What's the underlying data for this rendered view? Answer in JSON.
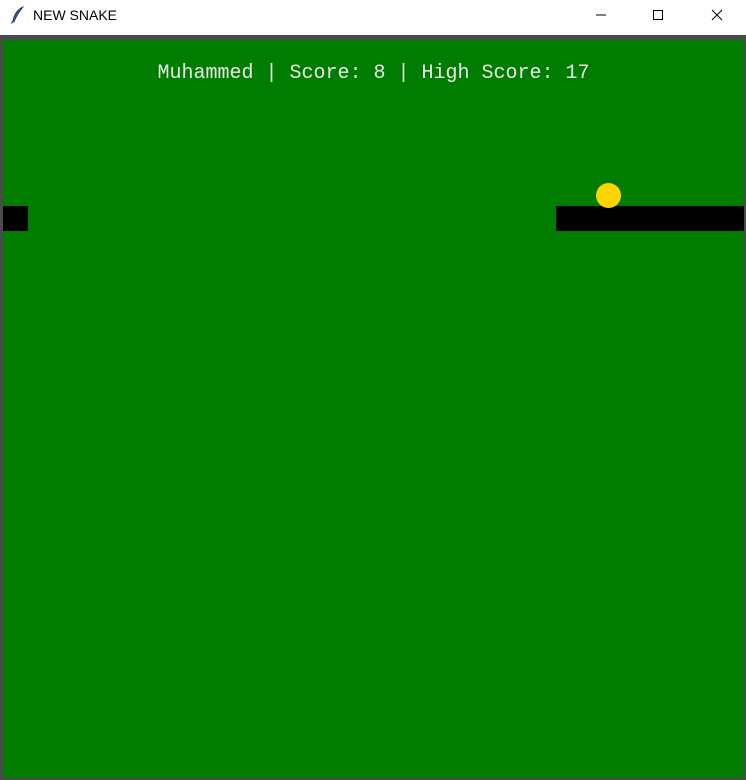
{
  "window": {
    "title": "NEW SNAKE",
    "icon": "feather-icon",
    "controls": [
      "minimize-icon",
      "maximize-icon",
      "close-icon"
    ]
  },
  "game": {
    "scoreboard": "Muhammed | Score: 8 | High Score: 17",
    "player": "Muhammed",
    "score": 8,
    "high_score": 17,
    "colors": {
      "background": "#007c00",
      "snake": "#000000",
      "food": "#ffd400",
      "text": "#e8e8e8"
    }
  }
}
